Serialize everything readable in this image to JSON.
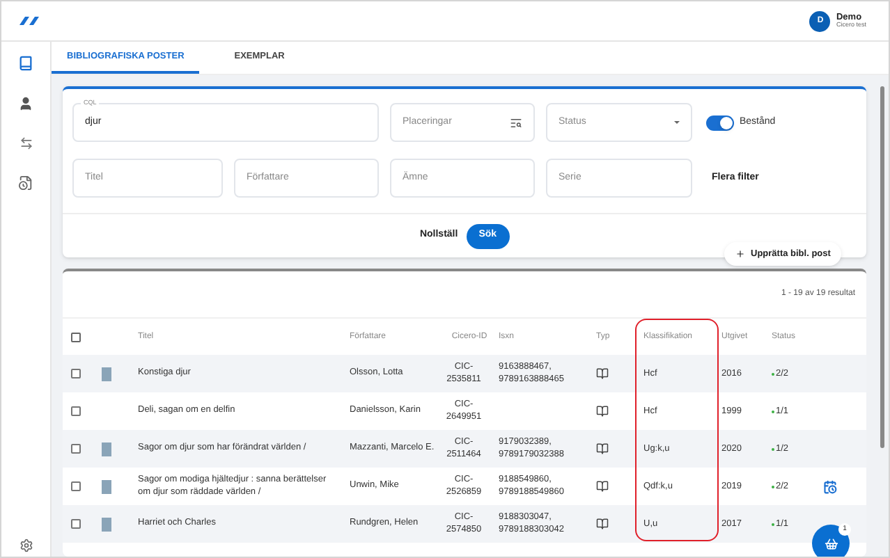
{
  "user": {
    "initial": "D",
    "name": "Demo",
    "org": "Cicero test"
  },
  "tabs": [
    {
      "label": "BIBLIOGRAFISKA POSTER",
      "selected": true
    },
    {
      "label": "EXEMPLAR",
      "selected": false
    }
  ],
  "search": {
    "cql_label": "CQL",
    "cql_value": "djur",
    "placement_placeholder": "Placeringar",
    "status_placeholder": "Status",
    "holdings_toggle": {
      "label": "Bestånd",
      "on": true
    },
    "fields": [
      {
        "placeholder": "Titel"
      },
      {
        "placeholder": "Författare"
      },
      {
        "placeholder": "Ämne"
      },
      {
        "placeholder": "Serie"
      }
    ],
    "more_filters": "Flera filter",
    "reset": "Nollställ",
    "submit": "Sök"
  },
  "create_button": "Upprätta bibl. post",
  "results": {
    "count": "1 - 19 av 19 resultat",
    "all_selected": false,
    "columns": [
      "Titel",
      "Författare",
      "Cicero-ID",
      "Isxn",
      "Typ",
      "Klassifikation",
      "Utgivet",
      "Status"
    ],
    "rows": [
      {
        "checked": false,
        "cover": true,
        "title": "Konstiga djur",
        "author": "Olsson, Lotta",
        "id": "CIC-2535811",
        "isxn": "9163888467, 9789163888465",
        "classification": "Hcf",
        "year": "2016",
        "status": "2/2",
        "reservation": false
      },
      {
        "checked": false,
        "cover": false,
        "title": "Deli, sagan om en delfin",
        "author": "Danielsson, Karin",
        "id": "CIC-2649951",
        "isxn": "",
        "classification": "Hcf",
        "year": "1999",
        "status": "1/1",
        "reservation": false
      },
      {
        "checked": false,
        "cover": true,
        "title": "Sagor om djur som har förändrat världen /",
        "author": "Mazzanti, Marcelo E.",
        "id": "CIC-2511464",
        "isxn": "9179032389, 9789179032388",
        "classification": "Ug:k,u",
        "year": "2020",
        "status": "1/2",
        "reservation": false
      },
      {
        "checked": false,
        "cover": true,
        "title": "Sagor om modiga hjältedjur : sanna berättelser om djur som räddade världen /",
        "author": "Unwin, Mike",
        "id": "CIC-2526859",
        "isxn": "9188549860, 9789188549860",
        "classification": "Qdf:k,u",
        "year": "2019",
        "status": "2/2",
        "reservation": true
      },
      {
        "checked": false,
        "cover": true,
        "title": "Harriet och Charles",
        "author": "Rundgren, Helen",
        "id": "CIC-2574850",
        "isxn": "9188303047, 9789188303042",
        "classification": "U,u",
        "year": "2017",
        "status": "1/1",
        "reservation": false
      }
    ]
  },
  "basket": {
    "count": "1"
  }
}
